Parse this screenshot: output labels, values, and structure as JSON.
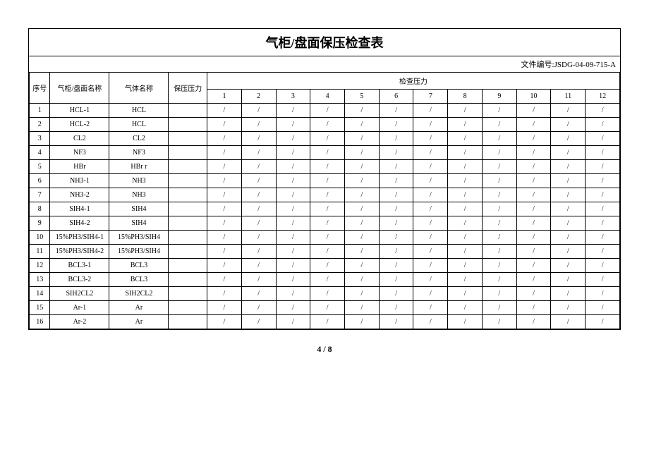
{
  "title": "气柜/盘面保压检查表",
  "doc_no_label": "文件编号:",
  "doc_no": "JSDG-04-09-715-A",
  "headers": {
    "seq": "序号",
    "cabinet_name": "气柜/盘面名称",
    "gas_name": "气体名称",
    "hold_pressure": "保压压力",
    "check_pressure": "检查压力",
    "cols": [
      "1",
      "2",
      "3",
      "4",
      "5",
      "6",
      "7",
      "8",
      "9",
      "10",
      "11",
      "12"
    ]
  },
  "rows": [
    {
      "seq": "1",
      "cabinet": "HCL-1",
      "gas": "HCL",
      "hold": "",
      "checks": [
        "/",
        "/",
        "/",
        "/",
        "/",
        "/",
        "/",
        "/",
        "/",
        "/",
        "/",
        "/"
      ]
    },
    {
      "seq": "2",
      "cabinet": "HCL-2",
      "gas": "HCL",
      "hold": "",
      "checks": [
        "/",
        "/",
        "/",
        "/",
        "/",
        "/",
        "/",
        "/",
        "/",
        "/",
        "/",
        "/"
      ]
    },
    {
      "seq": "3",
      "cabinet": "CL2",
      "gas": "CL2",
      "hold": "",
      "checks": [
        "/",
        "/",
        "/",
        "/",
        "/",
        "/",
        "/",
        "/",
        "/",
        "/",
        "/",
        "/"
      ]
    },
    {
      "seq": "4",
      "cabinet": "NF3",
      "gas": "NF3",
      "hold": "",
      "checks": [
        "/",
        "/",
        "/",
        "/",
        "/",
        "/",
        "/",
        "/",
        "/",
        "/",
        "/",
        "/"
      ]
    },
    {
      "seq": "5",
      "cabinet": "HBr",
      "gas": "HBr r",
      "hold": "",
      "checks": [
        "/",
        "/",
        "/",
        "/",
        "/",
        "/",
        "/",
        "/",
        "/",
        "/",
        "/",
        "/"
      ]
    },
    {
      "seq": "6",
      "cabinet": "NH3-1",
      "gas": "NH3",
      "hold": "",
      "checks": [
        "/",
        "/",
        "/",
        "/",
        "/",
        "/",
        "/",
        "/",
        "/",
        "/",
        "/",
        "/"
      ]
    },
    {
      "seq": "7",
      "cabinet": "NH3-2",
      "gas": "NH3",
      "hold": "",
      "checks": [
        "/",
        "/",
        "/",
        "/",
        "/",
        "/",
        "/",
        "/",
        "/",
        "/",
        "/",
        "/"
      ]
    },
    {
      "seq": "8",
      "cabinet": "SIH4-1",
      "gas": "SIH4",
      "hold": "",
      "checks": [
        "/",
        "/",
        "/",
        "/",
        "/",
        "/",
        "/",
        "/",
        "/",
        "/",
        "/",
        "/"
      ]
    },
    {
      "seq": "9",
      "cabinet": "SIH4-2",
      "gas": "SIH4",
      "hold": "",
      "checks": [
        "/",
        "/",
        "/",
        "/",
        "/",
        "/",
        "/",
        "/",
        "/",
        "/",
        "/",
        "/"
      ]
    },
    {
      "seq": "10",
      "cabinet": "15%PH3/SIH4-1",
      "gas": "15%PH3/SIH4",
      "hold": "",
      "checks": [
        "/",
        "/",
        "/",
        "/",
        "/",
        "/",
        "/",
        "/",
        "/",
        "/",
        "/",
        "/"
      ]
    },
    {
      "seq": "11",
      "cabinet": "15%PH3/SIH4-2",
      "gas": "15%PH3/SIH4",
      "hold": "",
      "checks": [
        "/",
        "/",
        "/",
        "/",
        "/",
        "/",
        "/",
        "/",
        "/",
        "/",
        "/",
        "/"
      ]
    },
    {
      "seq": "12",
      "cabinet": "BCL3-1",
      "gas": "BCL3",
      "hold": "",
      "checks": [
        "/",
        "/",
        "/",
        "/",
        "/",
        "/",
        "/",
        "/",
        "/",
        "/",
        "/",
        "/"
      ]
    },
    {
      "seq": "13",
      "cabinet": "BCL3-2",
      "gas": "BCL3",
      "hold": "",
      "checks": [
        "/",
        "/",
        "/",
        "/",
        "/",
        "/",
        "/",
        "/",
        "/",
        "/",
        "/",
        "/"
      ]
    },
    {
      "seq": "14",
      "cabinet": "SIH2CL2",
      "gas": "SIH2CL2",
      "hold": "",
      "checks": [
        "/",
        "/",
        "/",
        "/",
        "/",
        "/",
        "/",
        "/",
        "/",
        "/",
        "/",
        "/"
      ]
    },
    {
      "seq": "15",
      "cabinet": "Ar-1",
      "gas": "Ar",
      "hold": "",
      "checks": [
        "/",
        "/",
        "/",
        "/",
        "/",
        "/",
        "/",
        "/",
        "/",
        "/",
        "/",
        "/"
      ]
    },
    {
      "seq": "16",
      "cabinet": "Ar-2",
      "gas": "Ar",
      "hold": "",
      "checks": [
        "/",
        "/",
        "/",
        "/",
        "/",
        "/",
        "/",
        "/",
        "/",
        "/",
        "/",
        "/"
      ]
    }
  ],
  "pager": "4 / 8"
}
